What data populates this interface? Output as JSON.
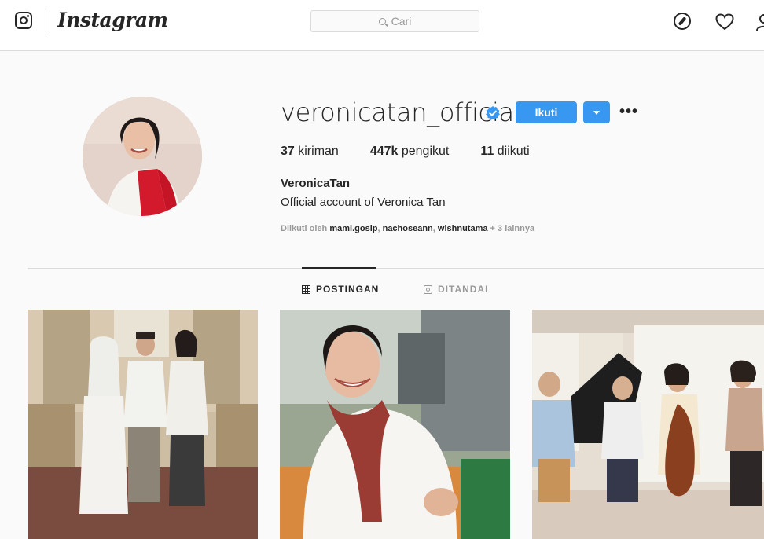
{
  "nav": {
    "wordmark": "Instagram",
    "search_placeholder": "Cari",
    "icons": [
      "instagram-glyph-icon",
      "compass-icon",
      "heart-icon",
      "user-icon"
    ]
  },
  "profile": {
    "username": "veronicatan_official",
    "verified": true,
    "follow_label": "Ikuti",
    "stats": [
      {
        "count": "37",
        "label": "kiriman"
      },
      {
        "count": "447k",
        "label": "pengikut"
      },
      {
        "count": "11",
        "label": "diikuti"
      }
    ],
    "full_name": "VeronicaTan",
    "bio": "Official account of Veronica Tan",
    "followed_by": {
      "prefix": "Diikuti oleh",
      "users": [
        "mami.gosip",
        "nachoseann",
        "wishnutama"
      ],
      "more": "+ 3 lainnya"
    }
  },
  "tabs": [
    {
      "label": "POSTINGAN",
      "active": true,
      "icon": "grid-icon"
    },
    {
      "label": "DITANDAI",
      "active": false,
      "icon": "tagged-icon"
    }
  ],
  "colors": {
    "accent": "#3897f0",
    "background": "#fafafa",
    "text": "#262626",
    "muted": "#999999",
    "border": "#dbdbdb"
  }
}
